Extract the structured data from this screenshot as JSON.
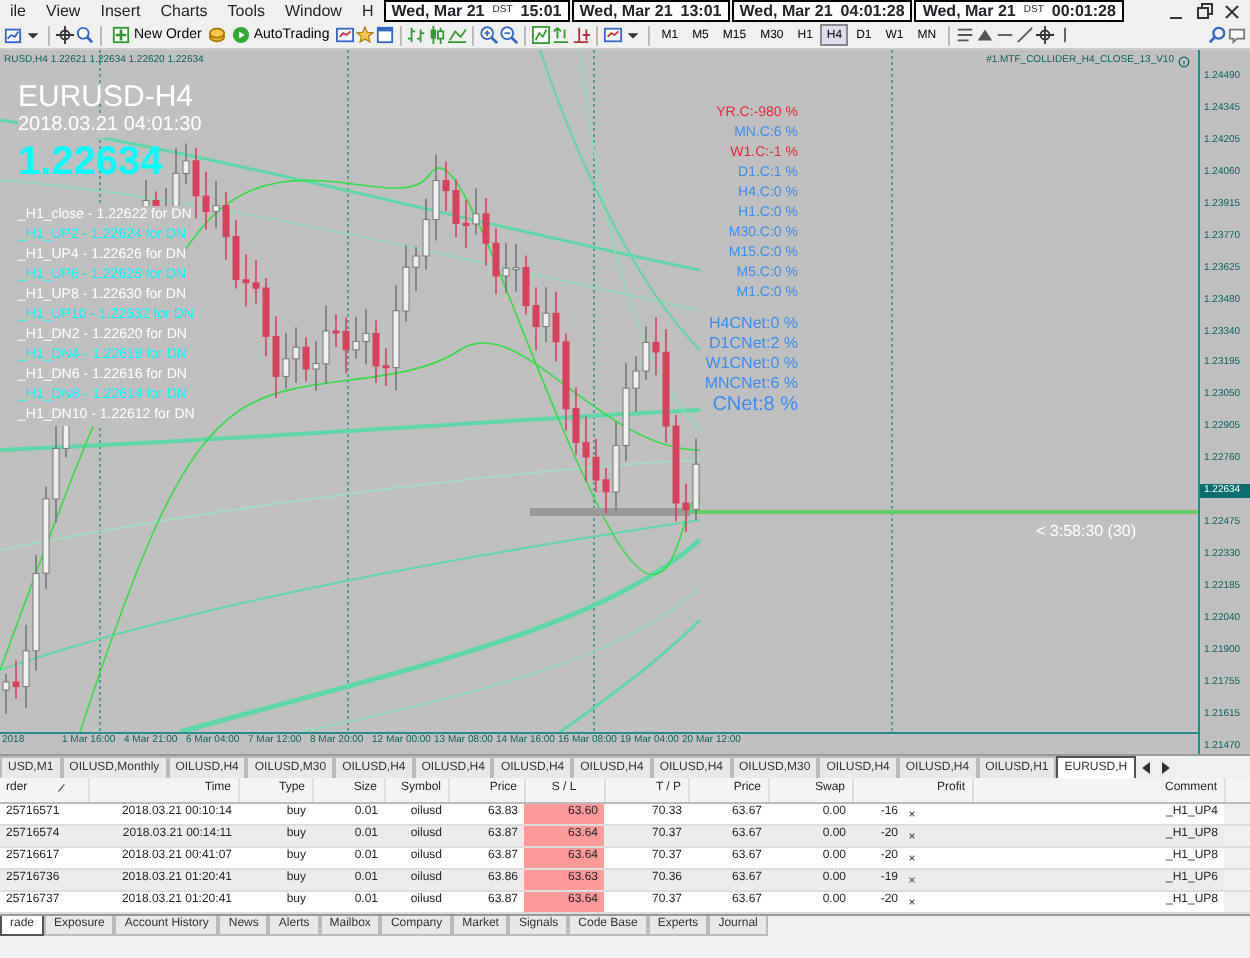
{
  "menu": [
    "ile",
    "View",
    "Insert",
    "Charts",
    "Tools",
    "Window",
    "H"
  ],
  "clocks": [
    {
      "date": "Wed, Mar 21",
      "zone": "DST",
      "time": "15:01"
    },
    {
      "date": "Wed, Mar 21",
      "time": "13:01"
    },
    {
      "date": "Wed, Mar 21",
      "time": "04:01:28"
    },
    {
      "date": "Wed, Mar 21",
      "zone": "DST",
      "time": "00:01:28"
    }
  ],
  "toolbar": {
    "new_order": "New Order",
    "auto_trading": "AutoTrading"
  },
  "timeframes": [
    {
      "label": "M1",
      "selected": false
    },
    {
      "label": "M5",
      "selected": false
    },
    {
      "label": "M15",
      "selected": false
    },
    {
      "label": "M30",
      "selected": false
    },
    {
      "label": "H1",
      "selected": false
    },
    {
      "label": "H4",
      "selected": true
    },
    {
      "label": "D1",
      "selected": false
    },
    {
      "label": "W1",
      "selected": false
    },
    {
      "label": "MN",
      "selected": false
    }
  ],
  "chart": {
    "header": "RUSD,H4 1.22621 1.22634 1.22620 1.22634",
    "indicator": "#1.MTF_COLLIDER_H4_CLOSE_13_V10",
    "symbol_title": "EURUSD-H4",
    "timestamp": "2018.03.21 04:01:30",
    "price": "1.22634",
    "levels": [
      {
        "text": "_H1_close - 1.22622 for DN",
        "color": "#ffffff"
      },
      {
        "text": "_H1_UP2 - 1.22624 for DN",
        "color": "#00ffff"
      },
      {
        "text": "_H1_UP4 - 1.22626 for DN",
        "color": "#ffffff"
      },
      {
        "text": "_H1_UP6 - 1.22628 for DN",
        "color": "#00ffff"
      },
      {
        "text": "_H1_UP8 - 1.22630 for DN",
        "color": "#ffffff"
      },
      {
        "text": "_H1_UP10 - 1.22632 for DN",
        "color": "#00ffff"
      },
      {
        "text": "_H1_DN2 - 1.22620 for DN",
        "color": "#ffffff"
      },
      {
        "text": "_H1_DN4 - 1.22618 for DN",
        "color": "#00ffff"
      },
      {
        "text": "_H1_DN6 - 1.22616 for DN",
        "color": "#ffffff"
      },
      {
        "text": "_H1_DN8 - 1.22614 for DN",
        "color": "#00ffff"
      },
      {
        "text": "_H1_DN10 - 1.22612 for DN",
        "color": "#ffffff"
      }
    ],
    "stats": [
      {
        "text": "YR.C:-980 %",
        "color": "#e8283c",
        "kind": "period"
      },
      {
        "text": "MN.C:6 %",
        "color": "#3c8cf0",
        "kind": "period"
      },
      {
        "text": "W1.C:-1 %",
        "color": "#e8283c",
        "kind": "period"
      },
      {
        "text": "D1.C:1 %",
        "color": "#3c8cf0",
        "kind": "period"
      },
      {
        "text": "H4.C:0 %",
        "color": "#3c8cf0",
        "kind": "period"
      },
      {
        "text": "H1.C:0 %",
        "color": "#3c8cf0",
        "kind": "period"
      },
      {
        "text": "M30.C:0 %",
        "color": "#3c8cf0",
        "kind": "period"
      },
      {
        "text": "M15.C:0 %",
        "color": "#3c8cf0",
        "kind": "period"
      },
      {
        "text": "M5.C:0 %",
        "color": "#3c8cf0",
        "kind": "period"
      },
      {
        "text": "M1.C:0 %",
        "color": "#3c8cf0",
        "kind": "period"
      },
      {
        "text": "H4CNet:0 %",
        "color": "#3c8cf0",
        "kind": "net"
      },
      {
        "text": "D1CNet:2 %",
        "color": "#3c8cf0",
        "kind": "net"
      },
      {
        "text": "W1CNet:0 %",
        "color": "#3c8cf0",
        "kind": "net"
      },
      {
        "text": "MNCNet:6 %",
        "color": "#3c8cf0",
        "kind": "net"
      },
      {
        "text": "CNet:8 %",
        "color": "#3c8cf0",
        "kind": "total"
      }
    ],
    "countdown": "< 3:58:30 (30)",
    "price_axis": [
      {
        "label": "1.24490",
        "current": false
      },
      {
        "label": "1.24345",
        "current": false
      },
      {
        "label": "1.24205",
        "current": false
      },
      {
        "label": "1.24060",
        "current": false
      },
      {
        "label": "1.23915",
        "current": false
      },
      {
        "label": "1.23770",
        "current": false
      },
      {
        "label": "1.23625",
        "current": false
      },
      {
        "label": "1.23480",
        "current": false
      },
      {
        "label": "1.23340",
        "current": false
      },
      {
        "label": "1.23195",
        "current": false
      },
      {
        "label": "1.23050",
        "current": false
      },
      {
        "label": "1.22905",
        "current": false
      },
      {
        "label": "1.22760",
        "current": false
      },
      {
        "label": "1.22634",
        "current": true
      },
      {
        "label": "1.22475",
        "current": false
      },
      {
        "label": "1.22330",
        "current": false
      },
      {
        "label": "1.22185",
        "current": false
      },
      {
        "label": "1.22040",
        "current": false
      },
      {
        "label": "1.21900",
        "current": false
      },
      {
        "label": "1.21755",
        "current": false
      },
      {
        "label": "1.21615",
        "current": false
      },
      {
        "label": "1.21470",
        "current": false
      }
    ],
    "time_axis": [
      "2018",
      "1 Mar 16:00",
      "4 Mar 21:00",
      "6 Mar 04:00",
      "7 Mar 12:00",
      "8 Mar 20:00",
      "12 Mar 00:00",
      "13 Mar 08:00",
      "14 Mar 16:00",
      "16 Mar 08:00",
      "19 Mar 04:00",
      "20 Mar 12:00"
    ]
  },
  "chart_tabs": [
    {
      "label": "USD,M1",
      "selected": false
    },
    {
      "label": "OILUSD,Monthly",
      "selected": false
    },
    {
      "label": "OILUSD,H4",
      "selected": false
    },
    {
      "label": "OILUSD,M30",
      "selected": false
    },
    {
      "label": "OILUSD,H4",
      "selected": false
    },
    {
      "label": "OILUSD,H4",
      "selected": false
    },
    {
      "label": "OILUSD,H4",
      "selected": false
    },
    {
      "label": "OILUSD,H4",
      "selected": false
    },
    {
      "label": "OILUSD,H4",
      "selected": false
    },
    {
      "label": "OILUSD,M30",
      "selected": false
    },
    {
      "label": "OILUSD,H4",
      "selected": false
    },
    {
      "label": "OILUSD,H4",
      "selected": false
    },
    {
      "label": "OILUSD,H1",
      "selected": false
    },
    {
      "label": "EURUSD,H",
      "selected": true
    }
  ],
  "trades": {
    "columns": [
      "rder",
      "Time",
      "Type",
      "Size",
      "Symbol",
      "Price",
      "S / L",
      "T / P",
      "Price",
      "Swap",
      "Profit",
      "Comment"
    ],
    "rows": [
      {
        "order": "25716571",
        "time": "2018.03.21 00:10:14",
        "type": "buy",
        "size": "0.01",
        "symbol": "oilusd",
        "price": "63.83",
        "sl": "63.60",
        "tp": "70.33",
        "current_price": "63.67",
        "swap": "0.00",
        "profit": "-16",
        "comment": "_H1_UP4"
      },
      {
        "order": "25716574",
        "time": "2018.03.21 00:14:11",
        "type": "buy",
        "size": "0.01",
        "symbol": "oilusd",
        "price": "63.87",
        "sl": "63.64",
        "tp": "70.37",
        "current_price": "63.67",
        "swap": "0.00",
        "profit": "-20",
        "comment": "_H1_UP8"
      },
      {
        "order": "25716617",
        "time": "2018.03.21 00:41:07",
        "type": "buy",
        "size": "0.01",
        "symbol": "oilusd",
        "price": "63.87",
        "sl": "63.64",
        "tp": "70.37",
        "current_price": "63.67",
        "swap": "0.00",
        "profit": "-20",
        "comment": "_H1_UP8"
      },
      {
        "order": "25716736",
        "time": "2018.03.21 01:20:41",
        "type": "buy",
        "size": "0.01",
        "symbol": "oilusd",
        "price": "63.86",
        "sl": "63.63",
        "tp": "70.36",
        "current_price": "63.67",
        "swap": "0.00",
        "profit": "-19",
        "comment": "_H1_UP6"
      },
      {
        "order": "25716737",
        "time": "2018.03.21 01:20:41",
        "type": "buy",
        "size": "0.01",
        "symbol": "oilusd",
        "price": "63.87",
        "sl": "63.64",
        "tp": "70.37",
        "current_price": "63.67",
        "swap": "0.00",
        "profit": "-20",
        "comment": "_H1_UP8"
      }
    ]
  },
  "terminal_tabs": [
    {
      "label": "rade",
      "selected": true
    },
    {
      "label": "Exposure",
      "selected": false
    },
    {
      "label": "Account History",
      "selected": false
    },
    {
      "label": "News",
      "selected": false
    },
    {
      "label": "Alerts",
      "selected": false
    },
    {
      "label": "Mailbox",
      "selected": false
    },
    {
      "label": "Company",
      "selected": false
    },
    {
      "label": "Market",
      "selected": false
    },
    {
      "label": "Signals",
      "selected": false
    },
    {
      "label": "Code Base",
      "selected": false
    },
    {
      "label": "Experts",
      "selected": false
    },
    {
      "label": "Journal",
      "selected": false
    }
  ]
}
